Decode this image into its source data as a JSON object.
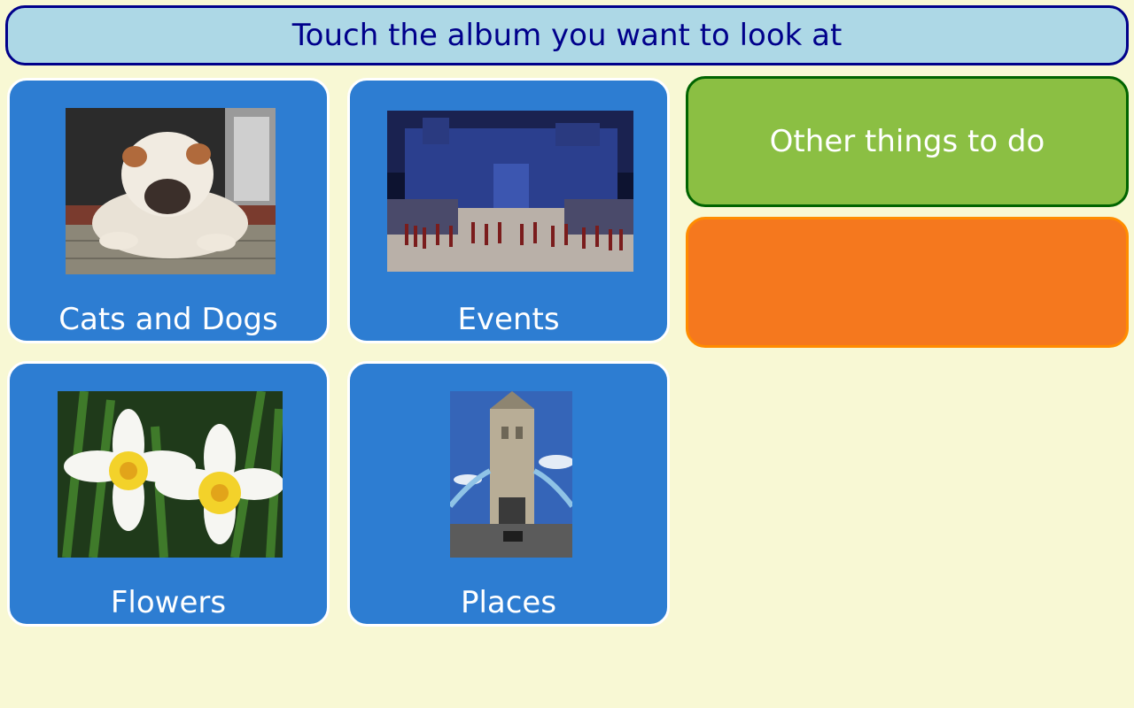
{
  "header": {
    "title": "Touch the album you want to look at"
  },
  "albums": [
    {
      "label": "Cats and Dogs",
      "image": "bulldog-photo"
    },
    {
      "label": "Events",
      "image": "castle-tattoo-photo"
    },
    {
      "label": "Flowers",
      "image": "daffodils-photo"
    },
    {
      "label": "Places",
      "image": "tower-bridge-photo"
    }
  ],
  "side": {
    "other_label": "Other things to do",
    "orange_label": ""
  },
  "colors": {
    "background": "#f8f8d4",
    "header_bg": "#add8e6",
    "header_text": "#00008b",
    "tile_bg": "#2d7dd2",
    "green_button": "#8bbf43",
    "orange_button": "#f5781e"
  }
}
